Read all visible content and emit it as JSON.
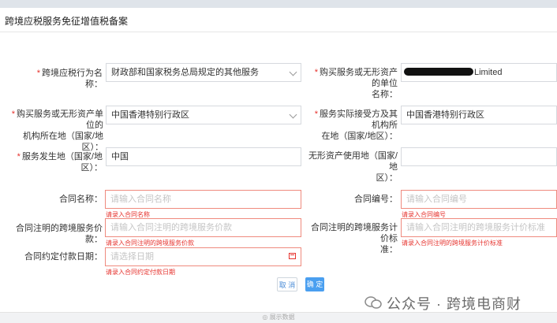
{
  "page": {
    "title": "跨境应税服务免征增值税备案"
  },
  "form": {
    "row1": {
      "left_label": "跨境应税行为名称：",
      "left_value": "财政部和国家税务总局规定的其他服务",
      "right_label_1": "购买服务或无形资产的单位",
      "right_label_2": "名称：",
      "right_value": "Limited"
    },
    "row2": {
      "left_label_1": "购买服务或无形资产单位的",
      "left_label_2": "机构所在地（国家/地区）：",
      "left_value": "中国香港特别行政区",
      "right_label_1": "服务实际接受方及其机构所",
      "right_label_2": "在地（国家/地区）：",
      "right_value": "中国香港特别行政区"
    },
    "row3": {
      "left_label": "服务发生地（国家/地区）：",
      "left_value": "中国",
      "right_label_1": "无形资产使用地（国家/地",
      "right_label_2": "区）："
    },
    "row4": {
      "left_label": "合同名称：",
      "left_placeholder": "请输入合同名称",
      "left_error": "请录入合同名称",
      "right_label": "合同编号：",
      "right_placeholder": "请输入合同编号",
      "right_error": "请录入合同编号"
    },
    "row5": {
      "left_label": "合同注明的跨境服务价款：",
      "left_placeholder": "请输入合同注明的跨境服务价款",
      "left_error": "请录入合同注明的跨境服务价款",
      "right_label_1": "合同注明的跨境服务计价标",
      "right_label_2": "准：",
      "right_placeholder": "请输入合同注明的跨境服务计价标准",
      "right_error": "请录入合同注明的跨境服务计价标准"
    },
    "row6": {
      "left_label": "合同约定付款日期：",
      "left_placeholder": "请选择日期",
      "left_error": "请录入合同约定付款日期"
    }
  },
  "buttons": {
    "cancel": "取 消",
    "confirm": "确 定"
  },
  "footer": {
    "text": "◎ 展示数据"
  },
  "watermark": {
    "text": "公众号 · 跨境电商财"
  },
  "colors": {
    "primary": "#4a9ff0",
    "error": "#e6322d"
  }
}
